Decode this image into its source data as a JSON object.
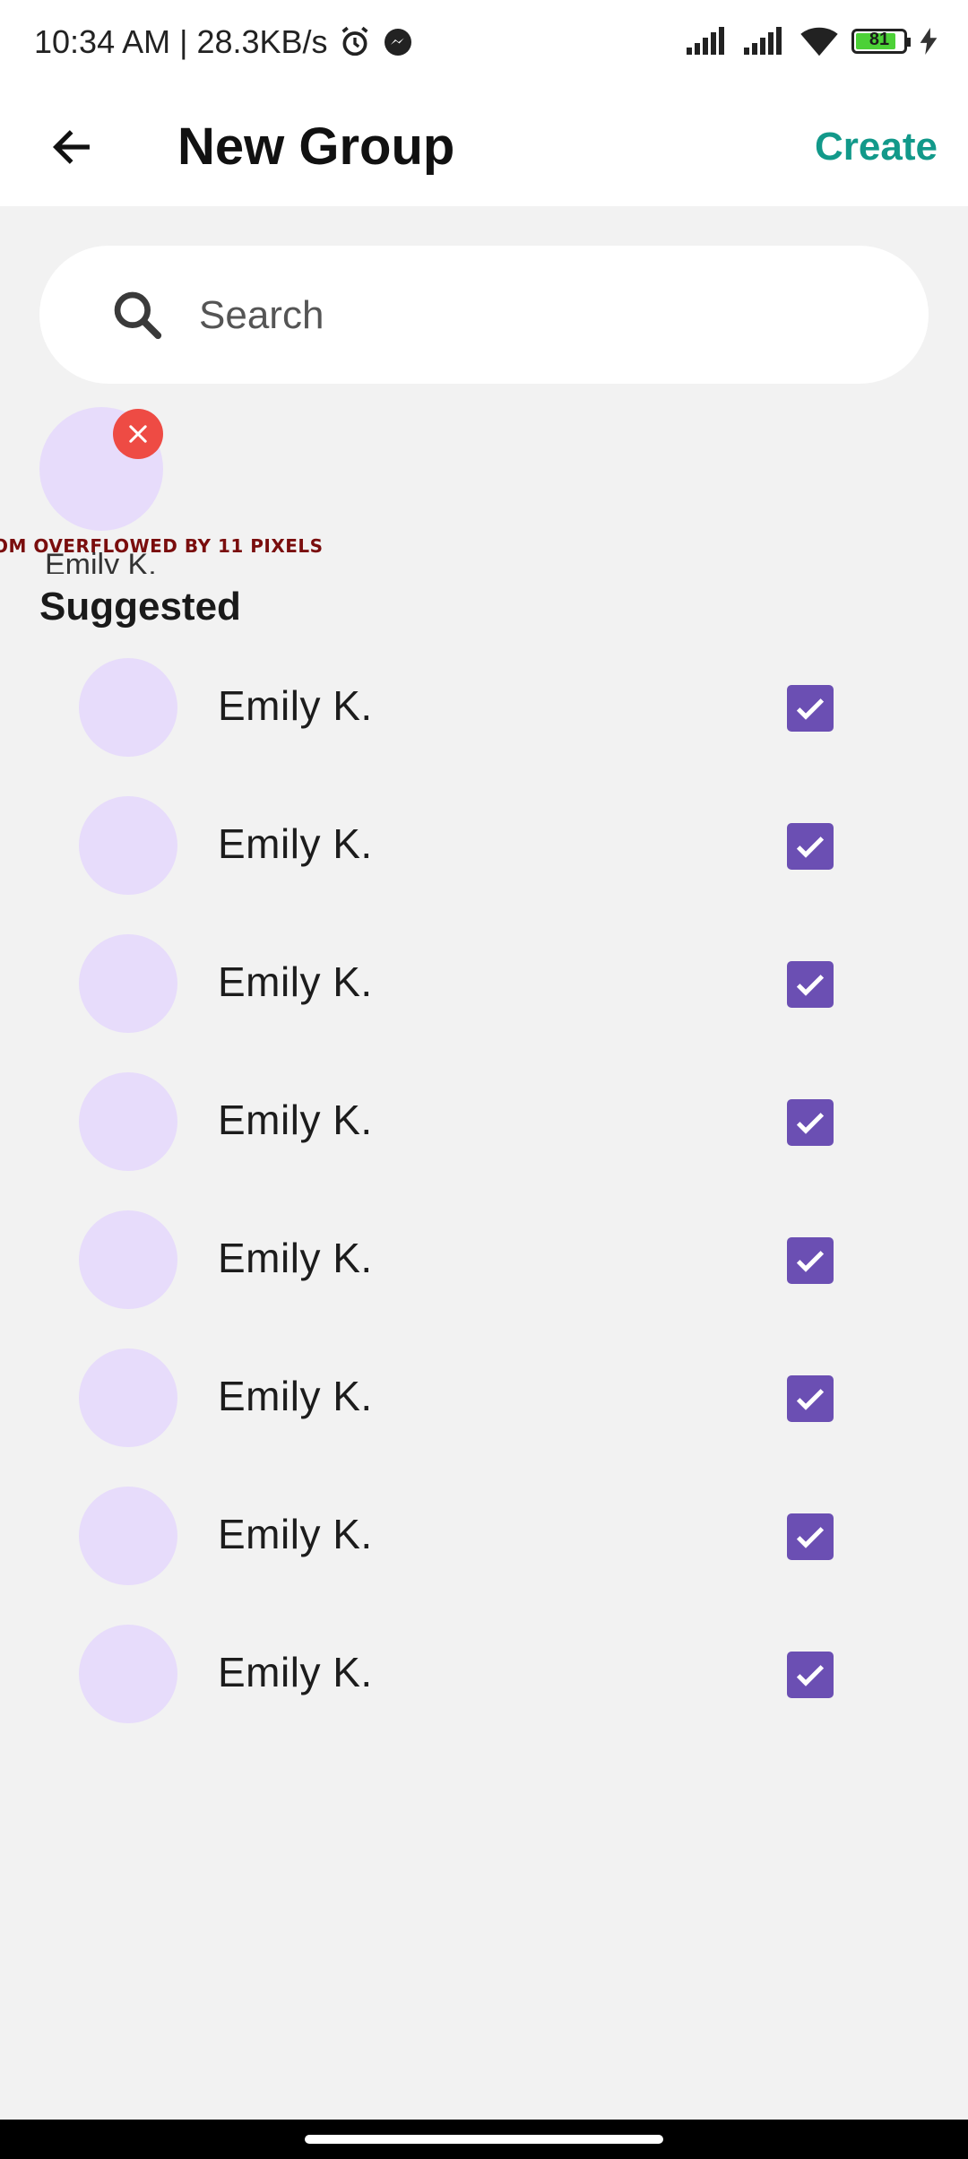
{
  "status_bar": {
    "time_speed": "10:34 AM | 28.3KB/s",
    "battery": "81",
    "icons": [
      "alarm-icon",
      "messenger-icon",
      "signal-icon",
      "signal-icon",
      "wifi-icon",
      "battery-icon",
      "charging-icon"
    ]
  },
  "header": {
    "title": "New Group",
    "action": "Create",
    "back_icon": "arrow-left-icon"
  },
  "search": {
    "placeholder": "Search",
    "icon": "search-icon"
  },
  "selected": {
    "name": "Emily K.",
    "remove_icon": "close-icon",
    "overflow_warning": "OM OVERFLOWED BY 11 PIXELS"
  },
  "suggested": {
    "title": "Suggested",
    "items": [
      {
        "name": "Emily K.",
        "checked": true
      },
      {
        "name": "Emily K.",
        "checked": true
      },
      {
        "name": "Emily K.",
        "checked": true
      },
      {
        "name": "Emily K.",
        "checked": true
      },
      {
        "name": "Emily K.",
        "checked": true
      },
      {
        "name": "Emily K.",
        "checked": true
      },
      {
        "name": "Emily K.",
        "checked": true
      },
      {
        "name": "Emily K.",
        "checked": true
      }
    ]
  },
  "colors": {
    "accent": "#12998a",
    "checkbox": "#6b4fb3",
    "avatar": "#e7dcfb",
    "remove": "#ee4b44",
    "background": "#f2f2f2"
  }
}
